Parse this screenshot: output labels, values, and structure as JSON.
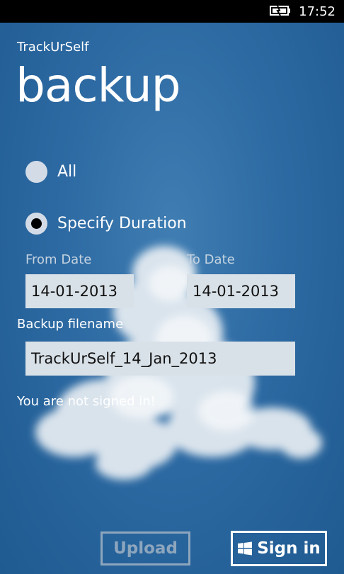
{
  "status_bar": {
    "time": "17:52",
    "battery_icon": "battery-charging-icon"
  },
  "app": {
    "name": "TrackUrSelf"
  },
  "page": {
    "title": "backup"
  },
  "options": {
    "all_label": "All",
    "specify_label": "Specify Duration",
    "selected": "specify"
  },
  "dates": {
    "from_label": "From Date",
    "from_value": "14-01-2013",
    "to_label": "To Date",
    "to_value": "14-01-2013"
  },
  "backup": {
    "filename_label": "Backup filename",
    "filename_value": "TrackUrSelf_14_Jan_2013"
  },
  "status_message": "You are not signed in!",
  "buttons": {
    "upload_label": "Upload",
    "signin_label": "Sign in",
    "signin_icon": "windows-logo-icon"
  }
}
